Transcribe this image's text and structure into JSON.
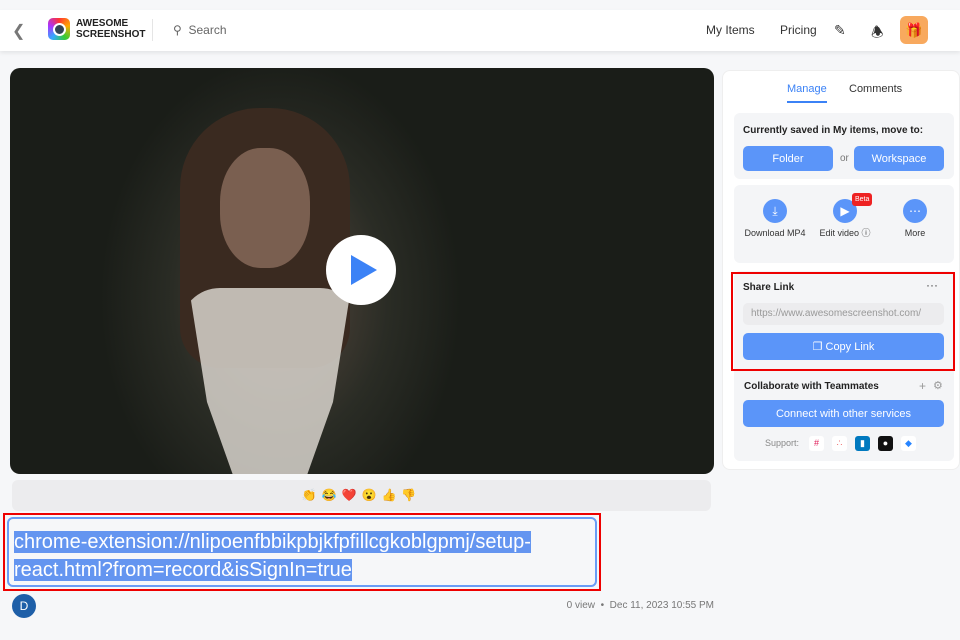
{
  "header": {
    "brand_line1": "AWESOME",
    "brand_line2": "SCREENSHOT",
    "search_placeholder": "Search",
    "nav": [
      "My Items",
      "Pricing"
    ]
  },
  "reactions": [
    "👏",
    "😂",
    "❤️",
    "😮",
    "👍",
    "👎"
  ],
  "url_text": "chrome-extension://nlipoenfbbikpbjkfpfillcgkoblgpmj/setup-react.html?from=record&isSignIn=true",
  "avatar_initial": "D",
  "meta": {
    "views": "0 view",
    "separator": "•",
    "date": "Dec 11, 2023 10:55 PM"
  },
  "panel": {
    "tabs": [
      "Manage",
      "Comments"
    ],
    "move_label": "Currently saved in My items, move to:",
    "folder": "Folder",
    "or": "or",
    "workspace": "Workspace",
    "actions": [
      {
        "label": "Download MP4"
      },
      {
        "label": "Edit video ⓘ",
        "badge": "Beta"
      },
      {
        "label": "More"
      }
    ],
    "share_title": "Share Link",
    "share_more": "···",
    "share_url": "https://www.awesomescreenshot.com/",
    "copy_link": "Copy Link",
    "collab_title": "Collaborate with Teammates",
    "connect": "Connect with other services",
    "support": "Support:"
  }
}
